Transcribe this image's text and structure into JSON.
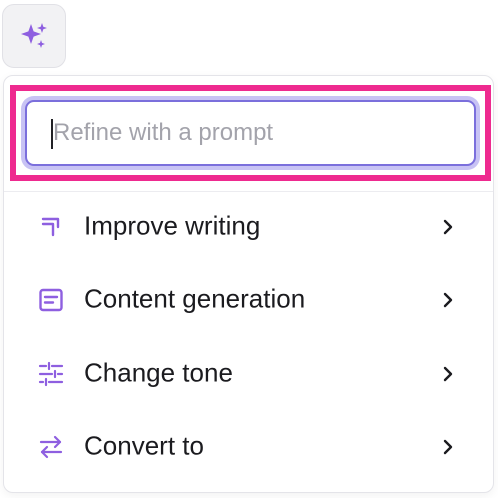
{
  "trigger": {
    "icon": "sparkles-icon",
    "color": "#8e5fe0"
  },
  "prompt": {
    "placeholder": "Refine with a prompt",
    "value": ""
  },
  "menu": {
    "items": [
      {
        "label": "Improve writing",
        "icon": "improve-writing-icon"
      },
      {
        "label": "Content generation",
        "icon": "document-text-icon"
      },
      {
        "label": "Change tone",
        "icon": "sliders-icon"
      },
      {
        "label": "Convert to",
        "icon": "swap-arrows-icon"
      }
    ]
  },
  "colors": {
    "accent": "#8e5fe0",
    "highlight": "#ee2a8f",
    "input_border": "#7b6fdc"
  }
}
